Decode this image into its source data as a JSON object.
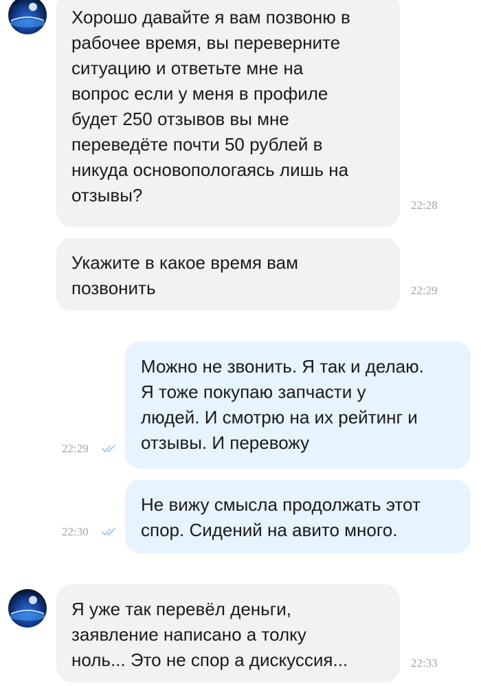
{
  "messages": [
    {
      "direction": "incoming",
      "lines": [
        "Хорошо давайте я вам позвоню в",
        "рабочее время, вы переверните",
        "ситуацию и ответьте мне на",
        "вопрос если у меня в профиле",
        "будет 250 отзывов вы мне",
        "переведёте почти 50 рублей в",
        "никуда основопологаясь лишь на",
        "отзывы?"
      ],
      "time": "22:28",
      "avatar_icon": "contact-avatar-icon"
    },
    {
      "direction": "incoming",
      "lines": [
        "Укажите в какое время вам",
        "позвонить"
      ],
      "time": "22:29"
    },
    {
      "direction": "outgoing",
      "lines": [
        "Можно не звонить. Я так и делаю.",
        "Я тоже покупаю запчасти у",
        "людей. И смотрю на их рейтинг и",
        "отзывы. И перевожу"
      ],
      "time": "22:29",
      "status_icon": "double-check-icon"
    },
    {
      "direction": "outgoing",
      "lines": [
        "Не вижу смысла продолжать этот",
        "спор. Сидений на авито много."
      ],
      "time": "22:30",
      "status_icon": "double-check-icon"
    },
    {
      "direction": "incoming",
      "lines": [
        "Я уже так перевёл деньги,",
        "заявление написано а толку",
        "ноль... Это не спор а дискуссия..."
      ],
      "time": "22:33",
      "avatar_icon": "contact-avatar-icon"
    }
  ],
  "colors": {
    "incoming_bubble": "#f2f2f2",
    "outgoing_bubble": "#e7f3fd",
    "timestamp": "#a3a3a3",
    "read_check": "#8fc3ec"
  }
}
